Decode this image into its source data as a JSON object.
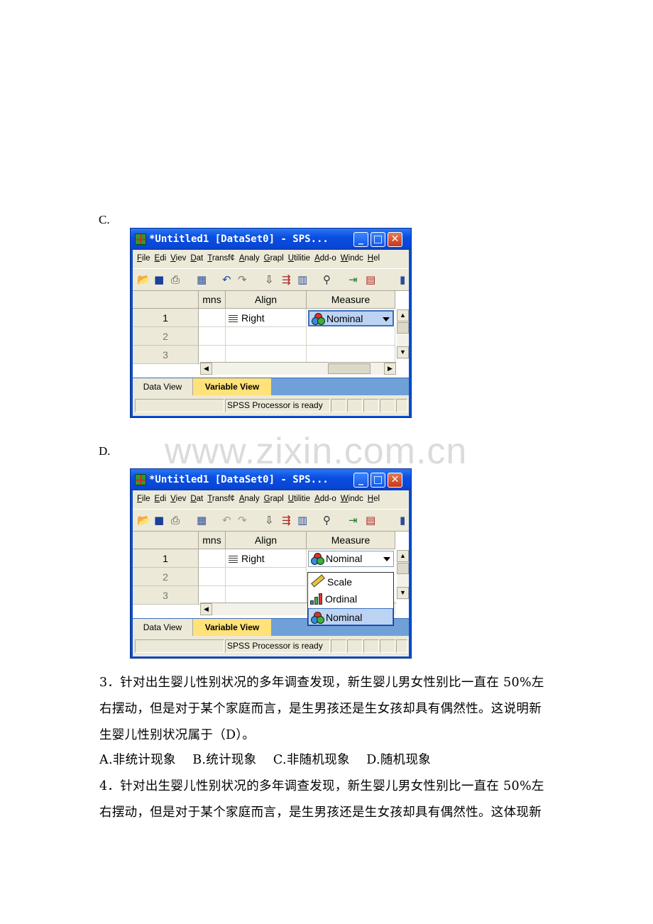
{
  "labels": {
    "c": "C.",
    "d": "D."
  },
  "watermark": "www.zixin.com.cn",
  "spss": {
    "title": "*Untitled1 [DataSet0] - SPS...",
    "window_buttons": {
      "minimize": "_",
      "maximize": "□",
      "close": "✕"
    },
    "menu": [
      "File",
      "Edi",
      "Viev",
      "Dat",
      "Transf¢",
      "Analy",
      "Grapl",
      "Utilitie",
      "Add-o",
      "Windc",
      "Hel"
    ],
    "columns": [
      "mns",
      "Align",
      "Measure"
    ],
    "rows": [
      "1",
      "2",
      "3"
    ],
    "row1": {
      "align": "Right",
      "measure": "Nominal"
    },
    "tabs": {
      "data_view": "Data View",
      "variable_view": "Variable View"
    },
    "status": "SPSS  Processor is ready",
    "measure_options": [
      "Scale",
      "Ordinal",
      "Nominal"
    ]
  },
  "paragraphs": {
    "q3_line1": "3．针对出生婴儿性别状况的多年调查发现，新生婴儿男女性别比一直在 50%左",
    "q3_line2": "右摆动，但是对于某个家庭而言，是生男孩还是生女孩却具有偶然性。这说明新",
    "q3_line3": "生婴儿性别状况属于（D）。",
    "q3_options": "A.非统计现象    B.统计现象    C.非随机现象    D.随机现象",
    "q4_line1": "4．针对出生婴儿性别状况的多年调查发现，新生婴儿男女性别比一直在 50%左",
    "q4_line2": "右摆动，但是对于某个家庭而言，是生男孩还是生女孩却具有偶然性。这体现新"
  }
}
